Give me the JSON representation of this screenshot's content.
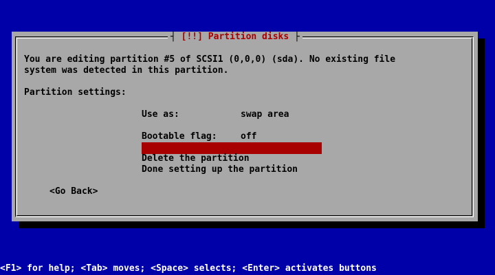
{
  "dialog": {
    "title": "[!!] Partition disks",
    "description_line1": "You are editing partition #5 of SCSI1 (0,0,0) (sda). No existing file",
    "description_line2": "system was detected in this partition.",
    "settings_heading": "Partition settings:"
  },
  "settings": {
    "use_as_label": "Use as:",
    "use_as_value": "swap area",
    "bootable_label": "Bootable flag:",
    "bootable_value": "off"
  },
  "menu": {
    "selected_item": "",
    "delete_item": "Delete the partition",
    "done_item": "Done setting up the partition"
  },
  "buttons": {
    "go_back": "<Go Back>"
  },
  "help_line": "<F1> for help; <Tab> moves; <Space> selects; <Enter> activates buttons",
  "colors": {
    "screen_background": "#0000a8",
    "dialog_background": "#a8a8a8",
    "title_text": "#a80000",
    "selection": "#a80000",
    "help_text": "#ffffff"
  }
}
